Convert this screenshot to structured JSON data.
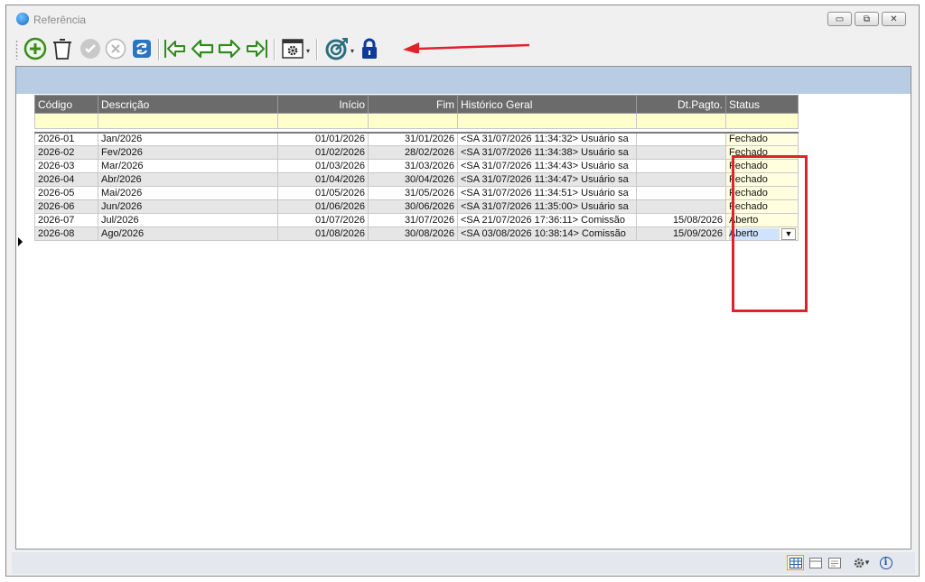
{
  "window": {
    "title": "Referência",
    "buttons": {
      "minimize": "▭",
      "restore": "⧉",
      "close": "✕"
    }
  },
  "toolbar": {
    "items": [
      "add-icon",
      "delete-icon",
      "confirm-icon",
      "cancel-icon",
      "refresh-icon",
      "first-record-icon",
      "previous-record-icon",
      "next-record-icon",
      "last-record-icon",
      "actions-menu-icon",
      "target-icon",
      "lock-icon"
    ]
  },
  "colors": {
    "accent_red": "#e0222b",
    "header_gray": "#6b6b6b",
    "filter_yellow": "#ffffcc",
    "band_blue": "#b8cce4"
  },
  "grid": {
    "columns": [
      "Código",
      "Descrição",
      "Início",
      "Fim",
      "Histórico Geral",
      "Dt.Pagto.",
      "Status"
    ],
    "rows": [
      {
        "codigo": "2026-01",
        "descricao": "Jan/2026",
        "inicio": "01/01/2026",
        "fim": "31/01/2026",
        "historico": "<SA 31/07/2026 11:34:32> Usuário sa",
        "dtpagto": "",
        "status": "Fechado"
      },
      {
        "codigo": "2026-02",
        "descricao": "Fev/2026",
        "inicio": "01/02/2026",
        "fim": "28/02/2026",
        "historico": "<SA 31/07/2026 11:34:38> Usuário sa",
        "dtpagto": "",
        "status": "Fechado"
      },
      {
        "codigo": "2026-03",
        "descricao": "Mar/2026",
        "inicio": "01/03/2026",
        "fim": "31/03/2026",
        "historico": "<SA 31/07/2026 11:34:43> Usuário sa",
        "dtpagto": "",
        "status": "Fechado"
      },
      {
        "codigo": "2026-04",
        "descricao": "Abr/2026",
        "inicio": "01/04/2026",
        "fim": "30/04/2026",
        "historico": "<SA 31/07/2026 11:34:47> Usuário sa",
        "dtpagto": "",
        "status": "Fechado"
      },
      {
        "codigo": "2026-05",
        "descricao": "Mai/2026",
        "inicio": "01/05/2026",
        "fim": "31/05/2026",
        "historico": "<SA 31/07/2026 11:34:51> Usuário sa",
        "dtpagto": "",
        "status": "Fechado"
      },
      {
        "codigo": "2026-06",
        "descricao": "Jun/2026",
        "inicio": "01/06/2026",
        "fim": "30/06/2026",
        "historico": "<SA 31/07/2026 11:35:00> Usuário sa",
        "dtpagto": "",
        "status": "Fechado"
      },
      {
        "codigo": "2026-07",
        "descricao": "Jul/2026",
        "inicio": "01/07/2026",
        "fim": "31/07/2026",
        "historico": "<SA 21/07/2026 17:36:11> Comissão",
        "dtpagto": "15/08/2026",
        "status": "Aberto"
      },
      {
        "codigo": "2026-08",
        "descricao": "Ago/2026",
        "inicio": "01/08/2026",
        "fim": "30/08/2026",
        "historico": "<SA 03/08/2026 10:38:14> Comissão",
        "dtpagto": "15/09/2026",
        "status": "Aberto"
      }
    ],
    "editing_row_index": 7,
    "status_dropdown_glyph": "▼"
  },
  "statusbar": {
    "items": [
      "grid-view-icon",
      "form-view-icon",
      "card-view-icon",
      "settings-icon",
      "info-icon"
    ],
    "settings_arrow": "▾",
    "info_glyph": "i"
  }
}
